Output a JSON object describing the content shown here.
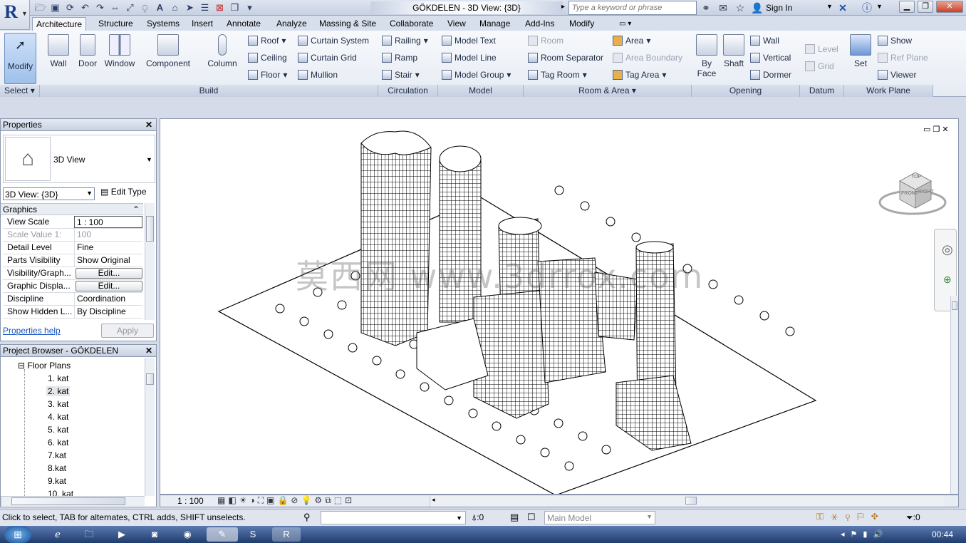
{
  "app": {
    "logo_letter": "R",
    "title": "GÖKDELEN - 3D View: {3D}",
    "search_placeholder": "Type a keyword or phrase",
    "sign_in": "Sign In"
  },
  "quick_access": [
    "open-icon",
    "save-icon",
    "sync-icon",
    "undo-icon",
    "redo-icon",
    "measure-icon",
    "dimension-icon",
    "tag-icon",
    "text-icon",
    "3d-view-icon",
    "section-icon",
    "thin-lines-icon",
    "close-hidden-icon",
    "switch-windows-icon"
  ],
  "tabs": [
    "Architecture",
    "Structure",
    "Systems",
    "Insert",
    "Annotate",
    "Analyze",
    "Massing & Site",
    "Collaborate",
    "View",
    "Manage",
    "Add-Ins",
    "Modify"
  ],
  "active_tab": "Architecture",
  "ribbon": {
    "select": {
      "modify": "Modify",
      "panel": "Select"
    },
    "build": {
      "panel": "Build",
      "wall": "Wall",
      "door": "Door",
      "window": "Window",
      "component": "Component",
      "column": "Column",
      "roof": "Roof",
      "ceiling": "Ceiling",
      "floor": "Floor",
      "curtain_system": "Curtain System",
      "curtain_grid": "Curtain Grid",
      "mullion": "Mullion"
    },
    "circulation": {
      "panel": "Circulation",
      "railing": "Railing",
      "ramp": "Ramp",
      "stair": "Stair"
    },
    "model": {
      "panel": "Model",
      "model_text": "Model Text",
      "model_line": "Model Line",
      "model_group": "Model Group"
    },
    "room_area": {
      "panel": "Room & Area",
      "room": "Room",
      "room_separator": "Room Separator",
      "tag_room": "Tag Room",
      "area": "Area",
      "area_boundary": "Area Boundary",
      "tag_area": "Tag Area"
    },
    "opening": {
      "panel": "Opening",
      "by_face": "By Face",
      "by_face_line2": "Face",
      "by_face_line1": "By",
      "shaft": "Shaft",
      "wall": "Wall",
      "vertical": "Vertical",
      "dormer": "Dormer"
    },
    "datum": {
      "panel": "Datum",
      "level": "Level",
      "grid": "Grid"
    },
    "work_plane": {
      "panel": "Work Plane",
      "set": "Set",
      "show": "Show",
      "ref_plane": "Ref Plane",
      "viewer": "Viewer"
    }
  },
  "properties": {
    "title": "Properties",
    "type_name": "3D View",
    "selector": "3D View: {3D}",
    "edit_type": "Edit Type",
    "section": "Graphics",
    "rows": [
      {
        "k": "View Scale",
        "v": "1 : 100"
      },
      {
        "k": "Scale Value    1:",
        "v": "100"
      },
      {
        "k": "Detail Level",
        "v": "Fine"
      },
      {
        "k": "Parts Visibility",
        "v": "Show Original"
      },
      {
        "k": "Visibility/Graph...",
        "v": "Edit..."
      },
      {
        "k": "Graphic Displa...",
        "v": "Edit..."
      },
      {
        "k": "Discipline",
        "v": "Coordination"
      },
      {
        "k": "Show Hidden L...",
        "v": "By Discipline"
      }
    ],
    "help": "Properties help",
    "apply": "Apply"
  },
  "browser": {
    "title": "Project Browser - GÖKDELEN",
    "group": "Floor Plans",
    "items": [
      "1. kat",
      "2. kat",
      "3. kat",
      "4. kat",
      "5. kat",
      "6. kat",
      "7.kat",
      "8.kat",
      "9.kat",
      "10. kat"
    ],
    "selected": "2. kat"
  },
  "viewbar": {
    "scale": "1 : 100"
  },
  "watermark": "莫西网 www.3drrox.com",
  "viewcube": {
    "top": "TOP",
    "front": "FRONT",
    "right": "RIGHT"
  },
  "status": {
    "hint": "Click to select, TAB for alternates, CTRL adds, SHIFT unselects.",
    "count": ":0",
    "model": "Main Model",
    "filter": ":0"
  },
  "taskbar": {
    "time": "00:44"
  }
}
